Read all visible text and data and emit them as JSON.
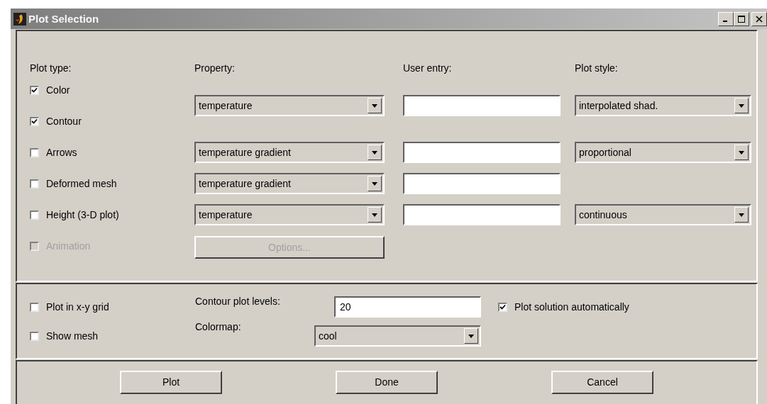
{
  "window": {
    "title": "Plot Selection"
  },
  "columns": [
    "Plot type:",
    "Property:",
    "User entry:",
    "Plot style:"
  ],
  "plot_groups": [
    {
      "types": [
        {
          "label": "Color",
          "checked": true,
          "disabled": false
        },
        {
          "label": "Contour",
          "checked": true,
          "disabled": false
        }
      ],
      "property": {
        "kind": "dropdown",
        "value": "temperature"
      },
      "user_entry_field": true,
      "plot_style": "interpolated shad."
    },
    {
      "types": [
        {
          "label": "Arrows",
          "checked": false,
          "disabled": false
        }
      ],
      "property": {
        "kind": "dropdown",
        "value": "temperature gradient"
      },
      "user_entry_field": true,
      "plot_style": "proportional"
    },
    {
      "types": [
        {
          "label": "Deformed mesh",
          "checked": false,
          "disabled": false
        }
      ],
      "property": {
        "kind": "dropdown",
        "value": "temperature gradient"
      },
      "user_entry_field": true
    },
    {
      "types": [
        {
          "label": "Height (3-D plot)",
          "checked": false,
          "disabled": false
        }
      ],
      "property": {
        "kind": "dropdown",
        "value": "temperature"
      },
      "user_entry_field": true,
      "plot_style": "continuous"
    },
    {
      "types": [
        {
          "label": "Animation",
          "checked": false,
          "disabled": true
        }
      ],
      "property": {
        "kind": "button",
        "value": "Options...",
        "disabled": true
      },
      "user_entry_field": false
    }
  ],
  "options": {
    "plot_in_xy_grid": {
      "label": "Plot in x-y grid",
      "checked": false
    },
    "show_mesh": {
      "label": "Show mesh",
      "checked": false
    },
    "contour_levels": {
      "label": "Contour plot levels:",
      "value": "20"
    },
    "colormap": {
      "label": "Colormap:",
      "value": "cool"
    },
    "plot_automatically": {
      "label": "Plot solution automatically",
      "checked": true
    }
  },
  "buttons": [
    "Plot",
    "Done",
    "Cancel"
  ]
}
